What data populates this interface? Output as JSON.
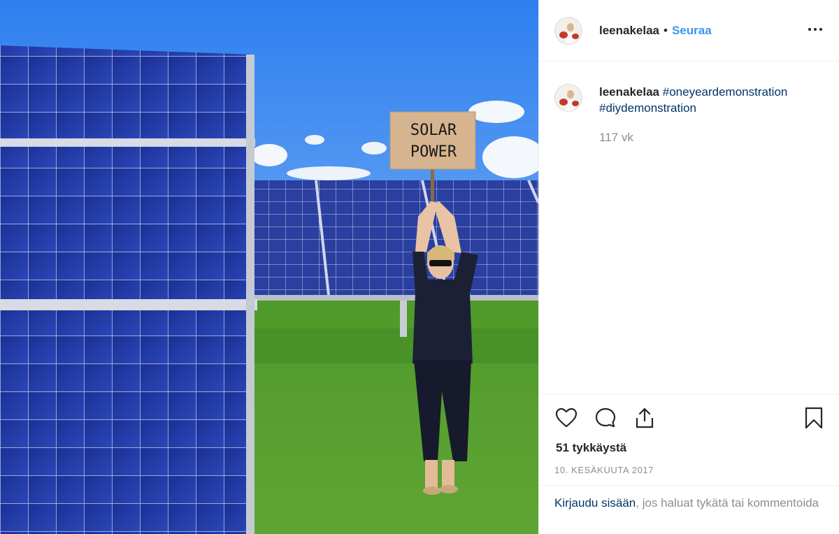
{
  "photo": {
    "sign_line1": "SOLAR",
    "sign_line2": "POWER"
  },
  "post": {
    "username": "leenakelaa",
    "dot": "•",
    "follow_label": "Seuraa",
    "caption": {
      "username": "leenakelaa",
      "hashtags": [
        "#oneyeardemonstration",
        "#diydemonstration"
      ],
      "time": "117 vk"
    },
    "likes": "51 tykkäystä",
    "date": "10. kesäkuuta 2017",
    "login": {
      "link": "Kirjaudu sisään",
      "rest": ", jos haluat tykätä tai kommentoida"
    }
  },
  "colors": {
    "link_blue": "#3897f0",
    "hashtag": "#003569",
    "muted": "#8e8e8e"
  },
  "icons": {
    "more": "more-options-icon",
    "like": "heart-icon",
    "comment": "comment-bubble-icon",
    "share": "share-upload-icon",
    "save": "bookmark-icon"
  }
}
